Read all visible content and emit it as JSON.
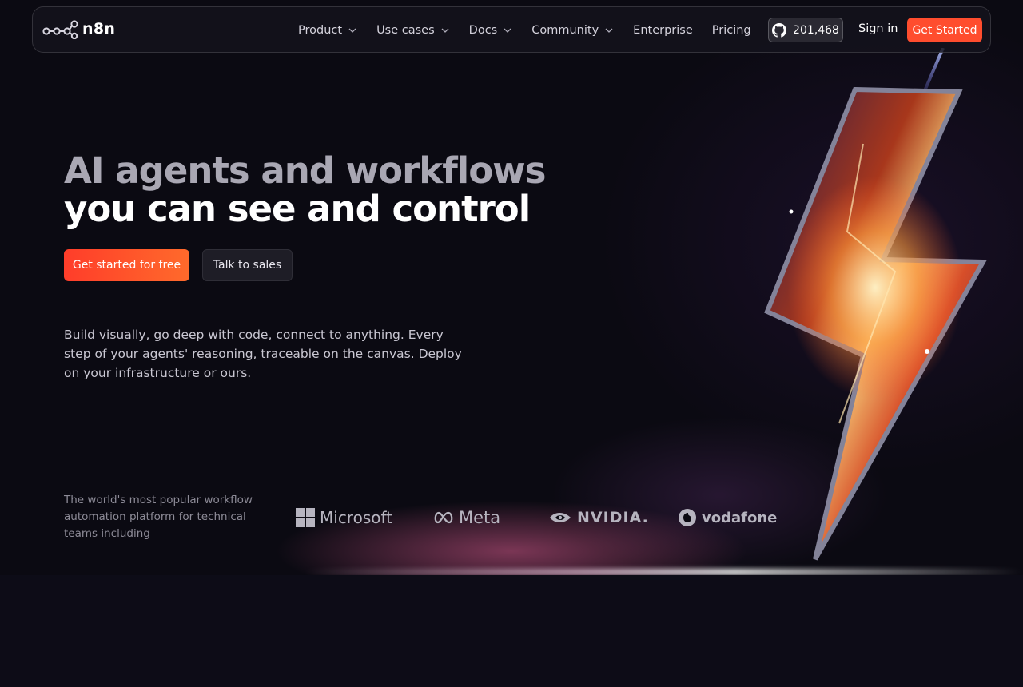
{
  "nav": {
    "logo_text": "n8n",
    "links": [
      {
        "label": "Product",
        "has_dropdown": true
      },
      {
        "label": "Use cases",
        "has_dropdown": true
      },
      {
        "label": "Docs",
        "has_dropdown": true
      },
      {
        "label": "Community",
        "has_dropdown": true
      },
      {
        "label": "Enterprise",
        "has_dropdown": false
      },
      {
        "label": "Pricing",
        "has_dropdown": false
      }
    ],
    "github_stars": "201,468",
    "github_icon": "github-icon",
    "signin_label": "Sign in",
    "get_started_label": "Get Started"
  },
  "hero": {
    "title_line1": "AI agents and workflows",
    "title_line2": "you can see and control",
    "cta_primary": "Get started for free",
    "cta_secondary": "Talk to sales",
    "description": "Build visually, go deep with code, connect to anything. Every step of your agents' reasoning, traceable on the canvas. Deploy on your infrastructure or ours."
  },
  "trust": {
    "text": "The world's most popular workflow automation platform for technical teams including",
    "brands": [
      "Microsoft",
      "Meta",
      "NVIDIA.",
      "vodafone"
    ]
  },
  "colors": {
    "accent": "#ff4d2e",
    "background": "#0b0a12",
    "nav_bg": "#14131c"
  }
}
